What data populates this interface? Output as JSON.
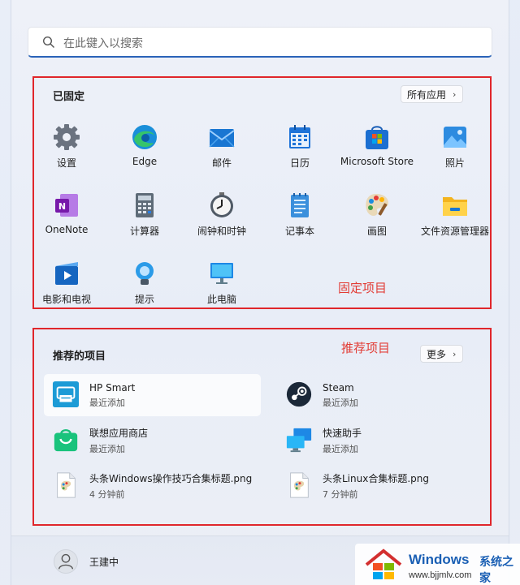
{
  "search": {
    "placeholder": "在此键入以搜索"
  },
  "pinned": {
    "title": "已固定",
    "all_apps_label": "所有应用",
    "annotation": "固定项目",
    "apps": [
      {
        "label": "设置",
        "icon": "settings-icon"
      },
      {
        "label": "Edge",
        "icon": "edge-icon"
      },
      {
        "label": "邮件",
        "icon": "mail-icon"
      },
      {
        "label": "日历",
        "icon": "calendar-icon"
      },
      {
        "label": "Microsoft Store",
        "icon": "store-icon"
      },
      {
        "label": "照片",
        "icon": "photos-icon"
      },
      {
        "label": "OneNote",
        "icon": "onenote-icon"
      },
      {
        "label": "计算器",
        "icon": "calculator-icon"
      },
      {
        "label": "闹钟和时钟",
        "icon": "clock-icon"
      },
      {
        "label": "记事本",
        "icon": "notepad-icon"
      },
      {
        "label": "画图",
        "icon": "paint-icon"
      },
      {
        "label": "文件资源管理器",
        "icon": "folder-icon"
      },
      {
        "label": "电影和电视",
        "icon": "movies-icon"
      },
      {
        "label": "提示",
        "icon": "tips-icon"
      },
      {
        "label": "此电脑",
        "icon": "pc-icon"
      }
    ]
  },
  "recommended": {
    "title": "推荐的项目",
    "more_label": "更多",
    "annotation": "推荐项目",
    "items": [
      {
        "name": "HP Smart",
        "sub": "最近添加",
        "icon": "hp-smart-icon"
      },
      {
        "name": "Steam",
        "sub": "最近添加",
        "icon": "steam-icon"
      },
      {
        "name": "联想应用商店",
        "sub": "最近添加",
        "icon": "lenovo-store-icon"
      },
      {
        "name": "快速助手",
        "sub": "最近添加",
        "icon": "quick-assist-icon"
      },
      {
        "name": "头条Windows操作技巧合集标题.png",
        "sub": "4 分钟前",
        "icon": "image-file-icon"
      },
      {
        "name": "头条Linux合集标题.png",
        "sub": "7 分钟前",
        "icon": "image-file-icon"
      }
    ]
  },
  "user": {
    "name": "王建中"
  },
  "watermark": {
    "title": "Windows",
    "cn": "系统之家",
    "url": "www.bjjmlv.com"
  },
  "colors": {
    "annotation_red": "#e0262b",
    "accent": "#2a63b8"
  }
}
